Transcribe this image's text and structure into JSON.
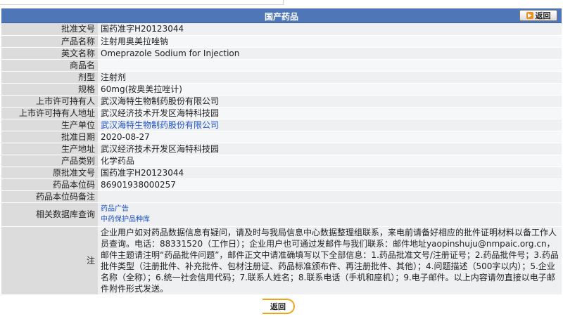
{
  "header": {
    "title": "国产药品",
    "back_label": "返回"
  },
  "rows": [
    {
      "label": "批准文号",
      "value": "国药准字H20123044",
      "link": false
    },
    {
      "label": "产品名称",
      "value": "注射用奥美拉唑钠",
      "link": false
    },
    {
      "label": "英文名称",
      "value": "Omeprazole Sodium for Injection",
      "link": false
    },
    {
      "label": "商品名",
      "value": "",
      "link": false
    },
    {
      "label": "剂型",
      "value": "注射剂",
      "link": false
    },
    {
      "label": "规格",
      "value": "60mg(按奥美拉唑计)",
      "link": false
    },
    {
      "label": "上市许可持有人",
      "value": "武汉海特生物制药股份有限公司",
      "link": false
    },
    {
      "label": "上市许可持有人地址",
      "value": "武汉经济技术开发区海特科技园",
      "link": false
    },
    {
      "label": "生产单位",
      "value": "武汉海特生物制药股份有限公司",
      "link": true
    },
    {
      "label": "批准日期",
      "value": "2020-08-27",
      "link": false
    },
    {
      "label": "生产地址",
      "value": "武汉经济技术开发区海特科技园",
      "link": false
    },
    {
      "label": "产品类别",
      "value": "化学药品",
      "link": false
    },
    {
      "label": "原批准文号",
      "value": "国药准字H20123044",
      "link": false
    },
    {
      "label": "药品本位码",
      "value": "86901938000257",
      "link": false
    },
    {
      "label": "药品本位码备注",
      "value": "",
      "link": false
    }
  ],
  "related": {
    "label": "相关数据库查询",
    "links": [
      "药品广告",
      "中药保护品种库"
    ]
  },
  "note": {
    "label": "注",
    "text": "企业用户如对药品数据信息有疑问，请及时与我局信息中心数据整理组联系，来电前请备好相应的批件证明材料以备工作人员查询。电话：88331520（工作日）；企业用户也可通过发邮件与我们联系：邮件地址yaopinshuju@nmpaic.org.cn，邮件主题请注明“药品批件问题”，邮件正文中请准确填写以下全部信息：1.药品批准文号/注册证号；2.药品批件号；3.药品批件类型（注册批件、补充批件、包材注册证、药品标准颁布件、再注册批件、其他）；4.问题描述（500字以内）；5.企业名称（全称）；6.统一社会信用代码；7.联系人姓名；8.联系电话（手机和座机）；9.电子邮件。以上内容请勿直接以电子邮件附件形式发送。"
  },
  "footer": {
    "back_label": "返回"
  },
  "colors": {
    "titlebar": "#4f76b6",
    "label_bg": "#dcdcdc",
    "value_bg": "#eef0f2",
    "link": "#1f53c8",
    "accent": "#f0a21a"
  }
}
